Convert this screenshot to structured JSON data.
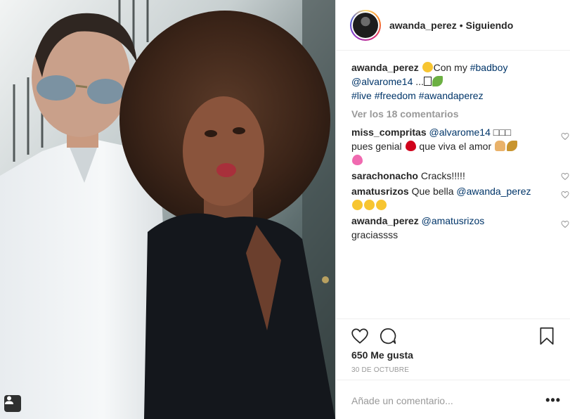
{
  "post": {
    "username": "awanda_perez",
    "separator": "•",
    "follow_status": "Siguiendo",
    "caption": {
      "username": "awanda_perez",
      "text_1": "Con my ",
      "tag_1": "#badboy",
      "mention": "@alvarome14",
      "text_2": " ...",
      "hashtags": [
        "#live",
        "#freedom",
        "#awandaperez"
      ]
    },
    "view_comments": "Ver los 18 comentarios",
    "comments": [
      {
        "user": "miss_compritas",
        "mention": "@alvarome14",
        "text_a": "□□□",
        "text_b": "pues genial",
        "text_c": "que viva el amor"
      },
      {
        "user": "sarachonacho",
        "text": "Cracks!!!!!"
      },
      {
        "user": "amatusrizos",
        "text": "Que bella",
        "mention": "@awanda_perez"
      },
      {
        "user": "awanda_perez",
        "mention": "@amatusrizos",
        "text": "graciassss"
      }
    ],
    "likes": "650 Me gusta",
    "date": "30 DE OCTUBRE",
    "add_comment_placeholder": "Añade un comentario...",
    "more": "•••"
  },
  "icons": {
    "photo_tag": "user-tag-icon",
    "like": "heart-icon",
    "comment": "comment-bubble-icon",
    "save": "bookmark-icon",
    "comment_like": "small-heart-icon"
  },
  "colors": {
    "link": "#003569",
    "muted": "#999999",
    "text": "#262626"
  }
}
